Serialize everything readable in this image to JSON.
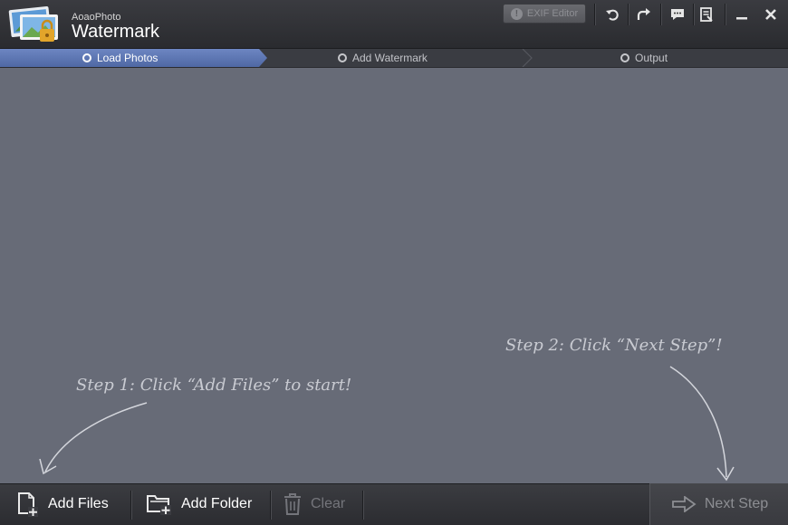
{
  "window": {
    "brand_small": "AoaoPhoto",
    "brand_big": "Watermark"
  },
  "toolbar": {
    "exif_label": "EXIF Editor",
    "icons": [
      "undo-icon",
      "redo-icon",
      "chat-icon",
      "notes-icon",
      "minimize-icon",
      "close-icon"
    ]
  },
  "steps": [
    {
      "label": "Load Photos",
      "active": true
    },
    {
      "label": "Add Watermark",
      "active": false
    },
    {
      "label": "Output",
      "active": false
    }
  ],
  "hints": {
    "step1": "Step 1: Click “Add Files” to start!",
    "step2": "Step 2: Click “Next Step”!"
  },
  "bottom": {
    "add_files": "Add Files",
    "add_folder": "Add Folder",
    "clear": "Clear",
    "next_step": "Next Step"
  },
  "colors": {
    "canvas": "#676b77",
    "active_step": "#5a74b0",
    "chrome": "#2f3034"
  }
}
